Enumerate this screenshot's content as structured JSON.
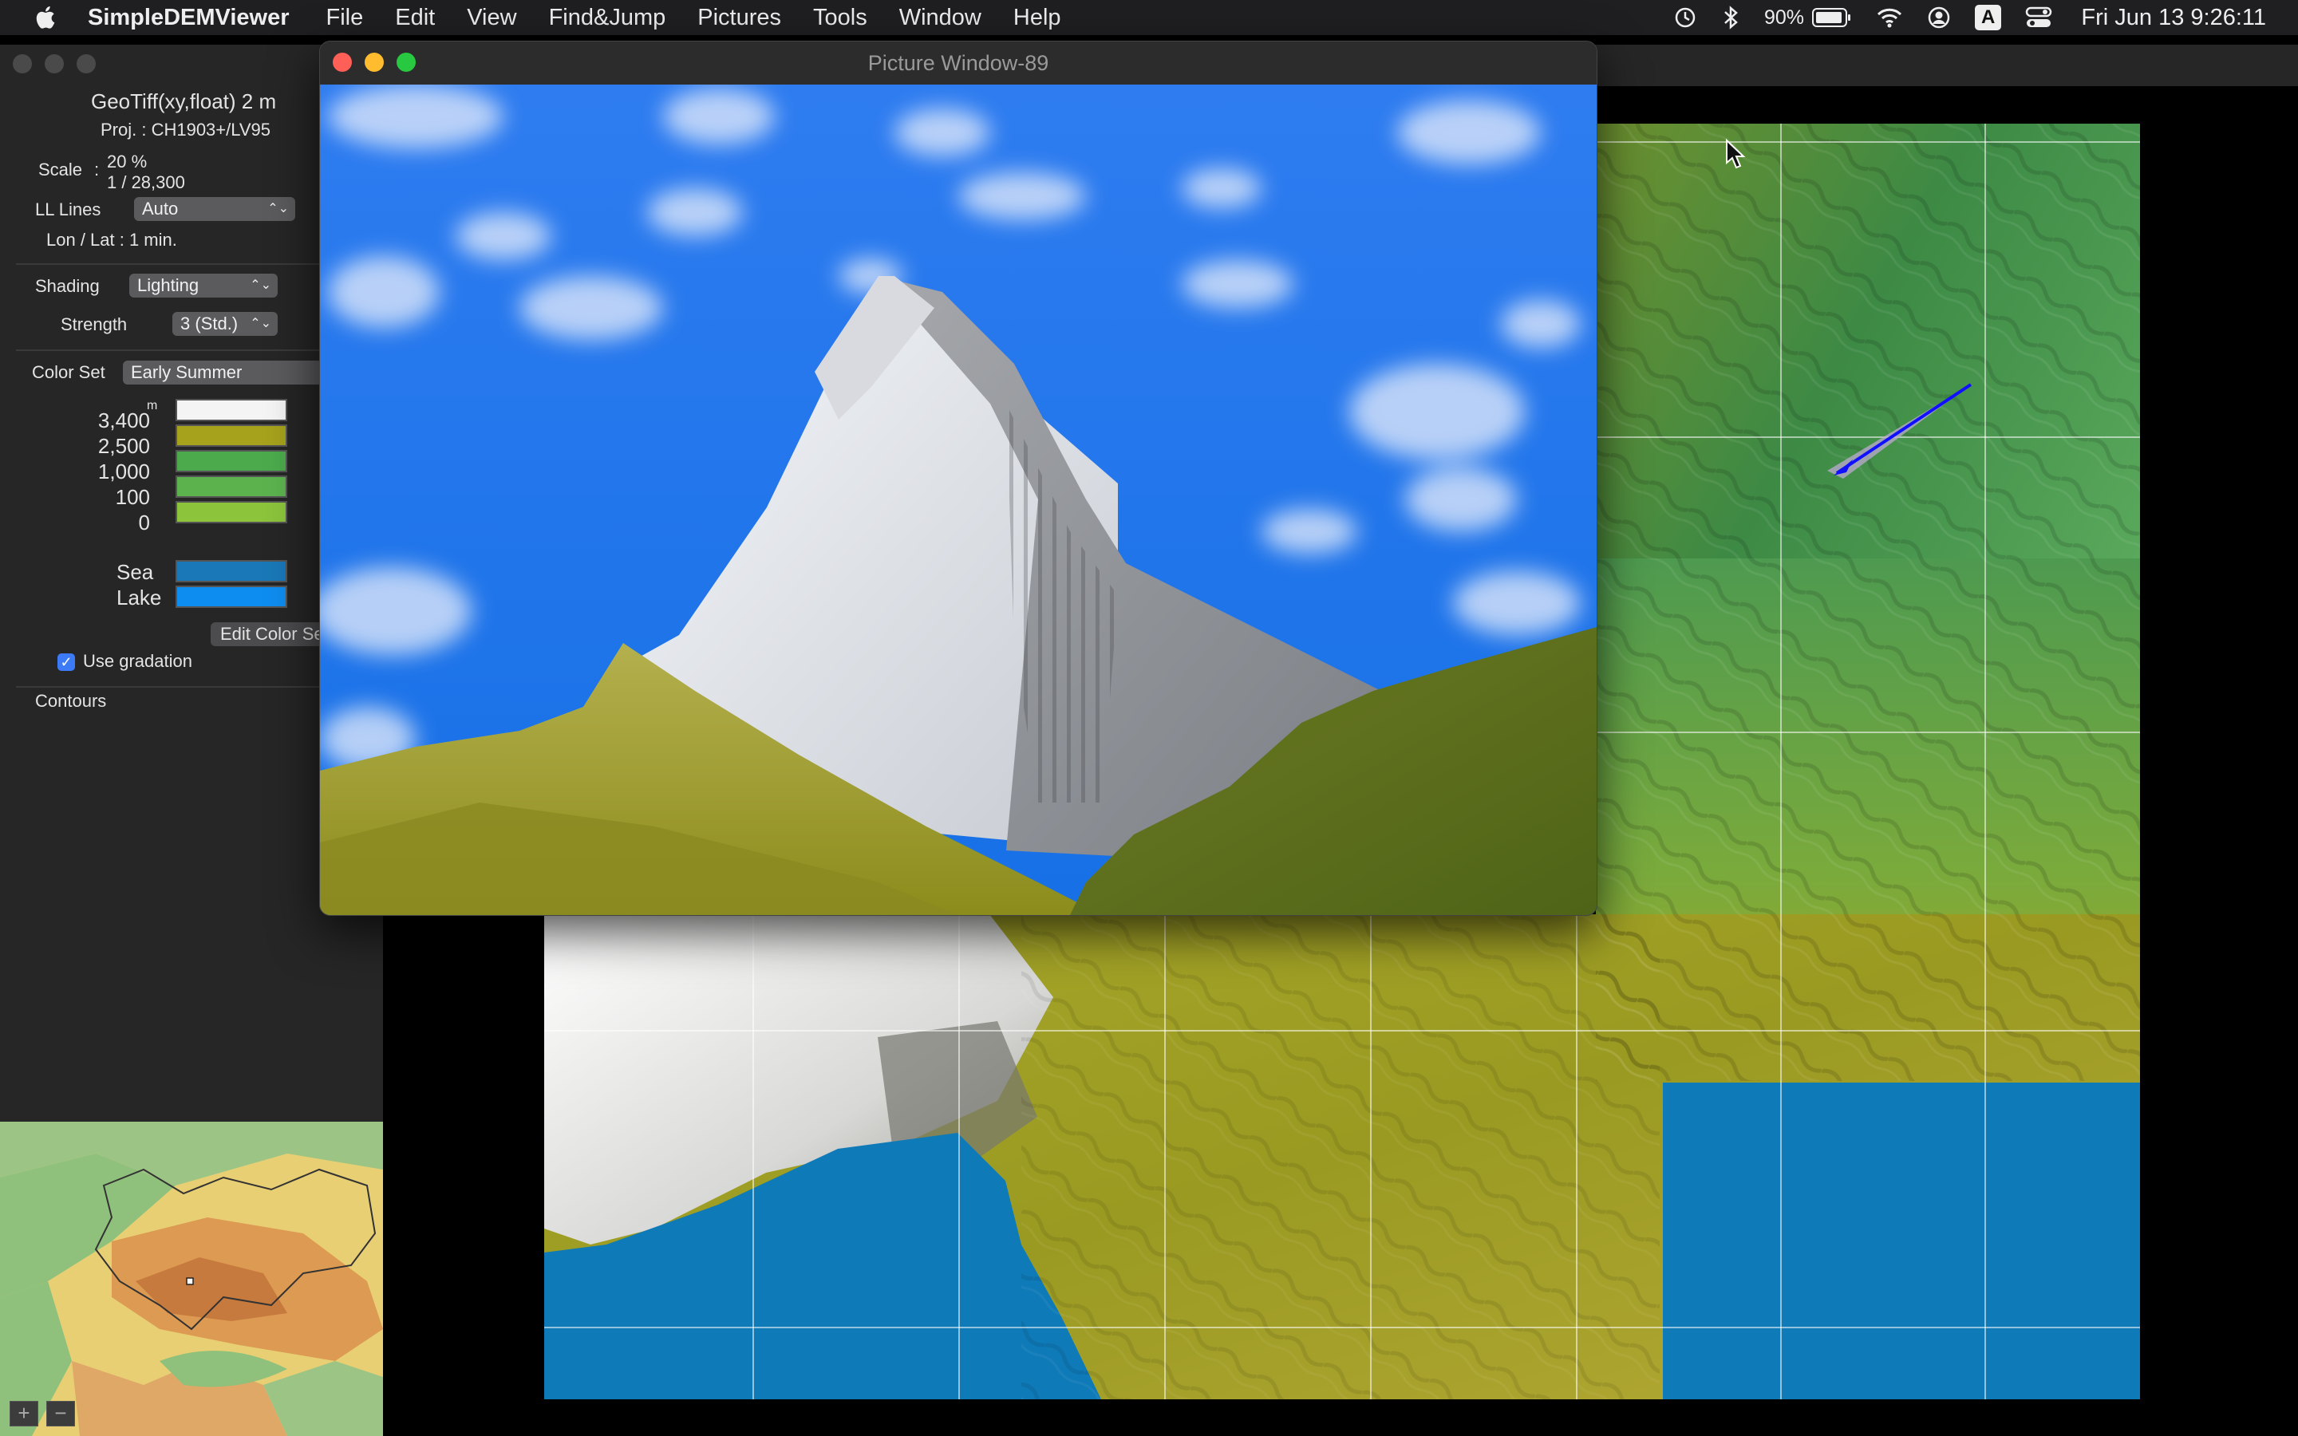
{
  "menubar": {
    "app_name": "SimpleDEMViewer",
    "items": [
      "File",
      "Edit",
      "View",
      "Find&Jump",
      "Pictures",
      "Tools",
      "Window",
      "Help"
    ],
    "battery": "90%",
    "input_source": "A",
    "clock": "Fri Jun 13  9:26:11"
  },
  "side_panel": {
    "file_type": "GeoTiff(xy,float) 2 m",
    "projection": "Proj. : CH1903+/LV95",
    "scale_label": "Scale",
    "scale_colon": ":",
    "scale_percent": "20 %",
    "scale_ratio": "1 /  28,300",
    "ll_lines_label": "LL Lines",
    "ll_lines_value": "Auto",
    "lonlat": "Lon / Lat : 1 min.",
    "shading_label": "Shading",
    "shading_value": "Lighting",
    "strength_label": "Strength",
    "strength_value": "3 (Std.)",
    "colorset_label": "Color Set",
    "colorset_value": "Early Summer",
    "unit": "m",
    "elevations": [
      {
        "label": "3,400",
        "color": "#f4f4f4"
      },
      {
        "label": "2,500",
        "color": "#a6a21c"
      },
      {
        "label": "1,000",
        "color": "#4caa4c"
      },
      {
        "label": "100",
        "color": "#5cb34e"
      },
      {
        "label": "0",
        "color": "#8cc43c"
      }
    ],
    "sea_label": "Sea",
    "sea_color": "#1a78b8",
    "lake_label": "Lake",
    "lake_color": "#0e8df0",
    "edit_color_button": "Edit Color Set",
    "use_gradation": "Use gradation",
    "contours": "Contours"
  },
  "overview": {
    "zoom_in": "+",
    "zoom_out": "−"
  },
  "picture_window": {
    "title": "Picture Window-89"
  }
}
